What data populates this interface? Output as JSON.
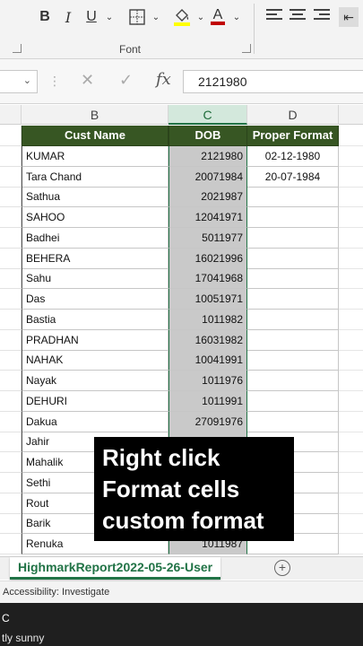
{
  "ribbon": {
    "bold": "B",
    "italic": "I",
    "underline": "U",
    "font_color_letter": "A",
    "group_label": "Font",
    "fill_color": "#ffff00",
    "font_color": "#c00000"
  },
  "formula_bar": {
    "fx": "fx",
    "value": "2121980"
  },
  "columns": [
    "B",
    "C",
    "D"
  ],
  "sheet": {
    "header": {
      "b": "Cust Name",
      "c": "DOB",
      "d": "Proper Format"
    },
    "rows": [
      {
        "b": "KUMAR",
        "c": "2121980",
        "d": "02-12-1980"
      },
      {
        "b": "Tara Chand",
        "c": "20071984",
        "d": "20-07-1984"
      },
      {
        "b": "Sathua",
        "c": "2021987",
        "d": ""
      },
      {
        "b": "SAHOO",
        "c": "12041971",
        "d": ""
      },
      {
        "b": "Badhei",
        "c": "5011977",
        "d": ""
      },
      {
        "b": "BEHERA",
        "c": "16021996",
        "d": ""
      },
      {
        "b": "Sahu",
        "c": "17041968",
        "d": ""
      },
      {
        "b": "Das",
        "c": "10051971",
        "d": ""
      },
      {
        "b": "Bastia",
        "c": "1011982",
        "d": ""
      },
      {
        "b": "PRADHAN",
        "c": "16031982",
        "d": ""
      },
      {
        "b": "NAHAK",
        "c": "10041991",
        "d": ""
      },
      {
        "b": "Nayak",
        "c": "1011976",
        "d": ""
      },
      {
        "b": "DEHURI",
        "c": "1011991",
        "d": ""
      },
      {
        "b": "Dakua",
        "c": "27091976",
        "d": ""
      },
      {
        "b": "Jahir",
        "c": "",
        "d": ""
      },
      {
        "b": "Mahalik",
        "c": "",
        "d": ""
      },
      {
        "b": "Sethi",
        "c": "",
        "d": ""
      },
      {
        "b": "Rout",
        "c": "",
        "d": ""
      },
      {
        "b": "Barik",
        "c": "",
        "d": ""
      },
      {
        "b": "Renuka",
        "c": "1011987",
        "d": ""
      }
    ]
  },
  "overlay": {
    "line1": "Right click",
    "line2": "Format cells",
    "line3": "custom format"
  },
  "sheet_tab": "HighmarkReport2022-05-26-User",
  "status": "Accessibility: Investigate",
  "taskbar": {
    "temp": "C",
    "weather": "tly sunny"
  }
}
